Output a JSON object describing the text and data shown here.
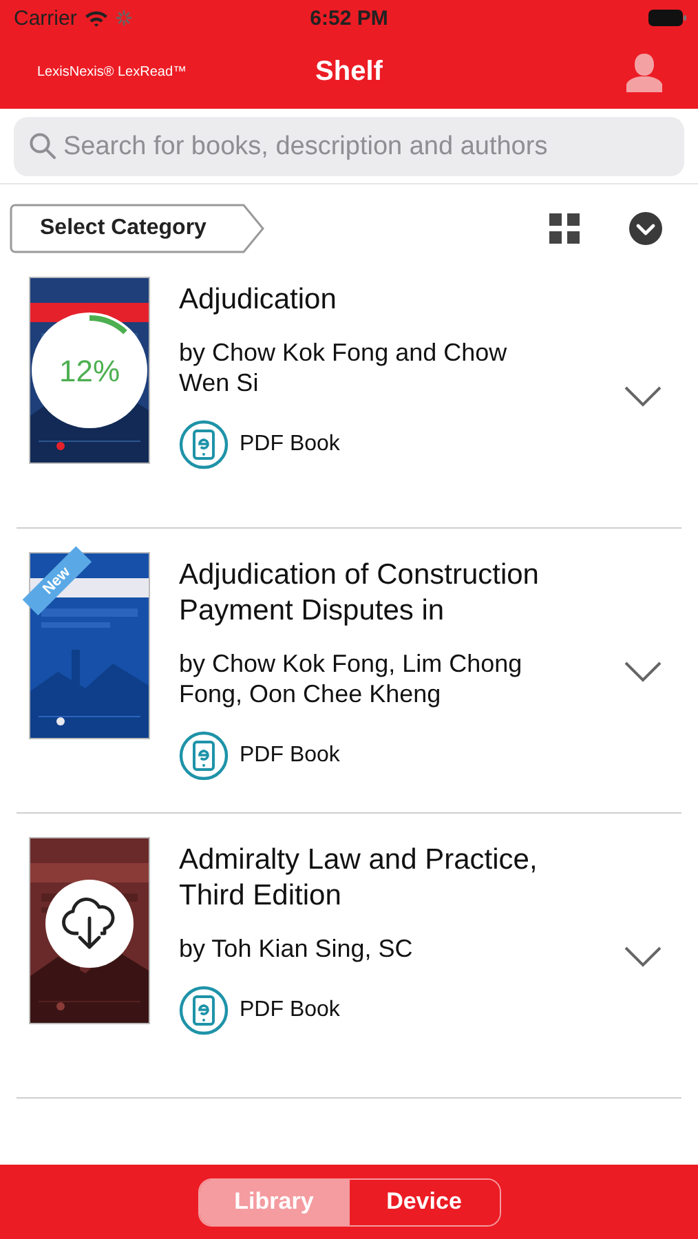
{
  "status_bar": {
    "carrier": "Carrier",
    "time": "6:52 PM"
  },
  "header": {
    "logo": "LexisNexis® LexRead™",
    "title": "Shelf"
  },
  "search": {
    "placeholder": "Search for books, description and authors"
  },
  "category_button": "Select Category",
  "books": [
    {
      "title": "Adjudication",
      "authors": "by Chow Kok Fong and Chow Wen Si",
      "format": "PDF Book",
      "overlay": {
        "kind": "progress",
        "text": "12%"
      }
    },
    {
      "title": "Adjudication of Construction Payment Disputes in",
      "authors": "by Chow Kok Fong, Lim Chong Fong, Oon Chee Kheng",
      "format": "PDF Book",
      "overlay": {
        "kind": "ribbon",
        "text": "New"
      }
    },
    {
      "title": "Admiralty Law and Practice, Third Edition",
      "authors": "by Toh Kian Sing, SC",
      "format": "PDF Book",
      "overlay": {
        "kind": "download"
      }
    }
  ],
  "tabs": [
    {
      "label": "Library",
      "selected": true
    },
    {
      "label": "Device",
      "selected": false
    }
  ]
}
